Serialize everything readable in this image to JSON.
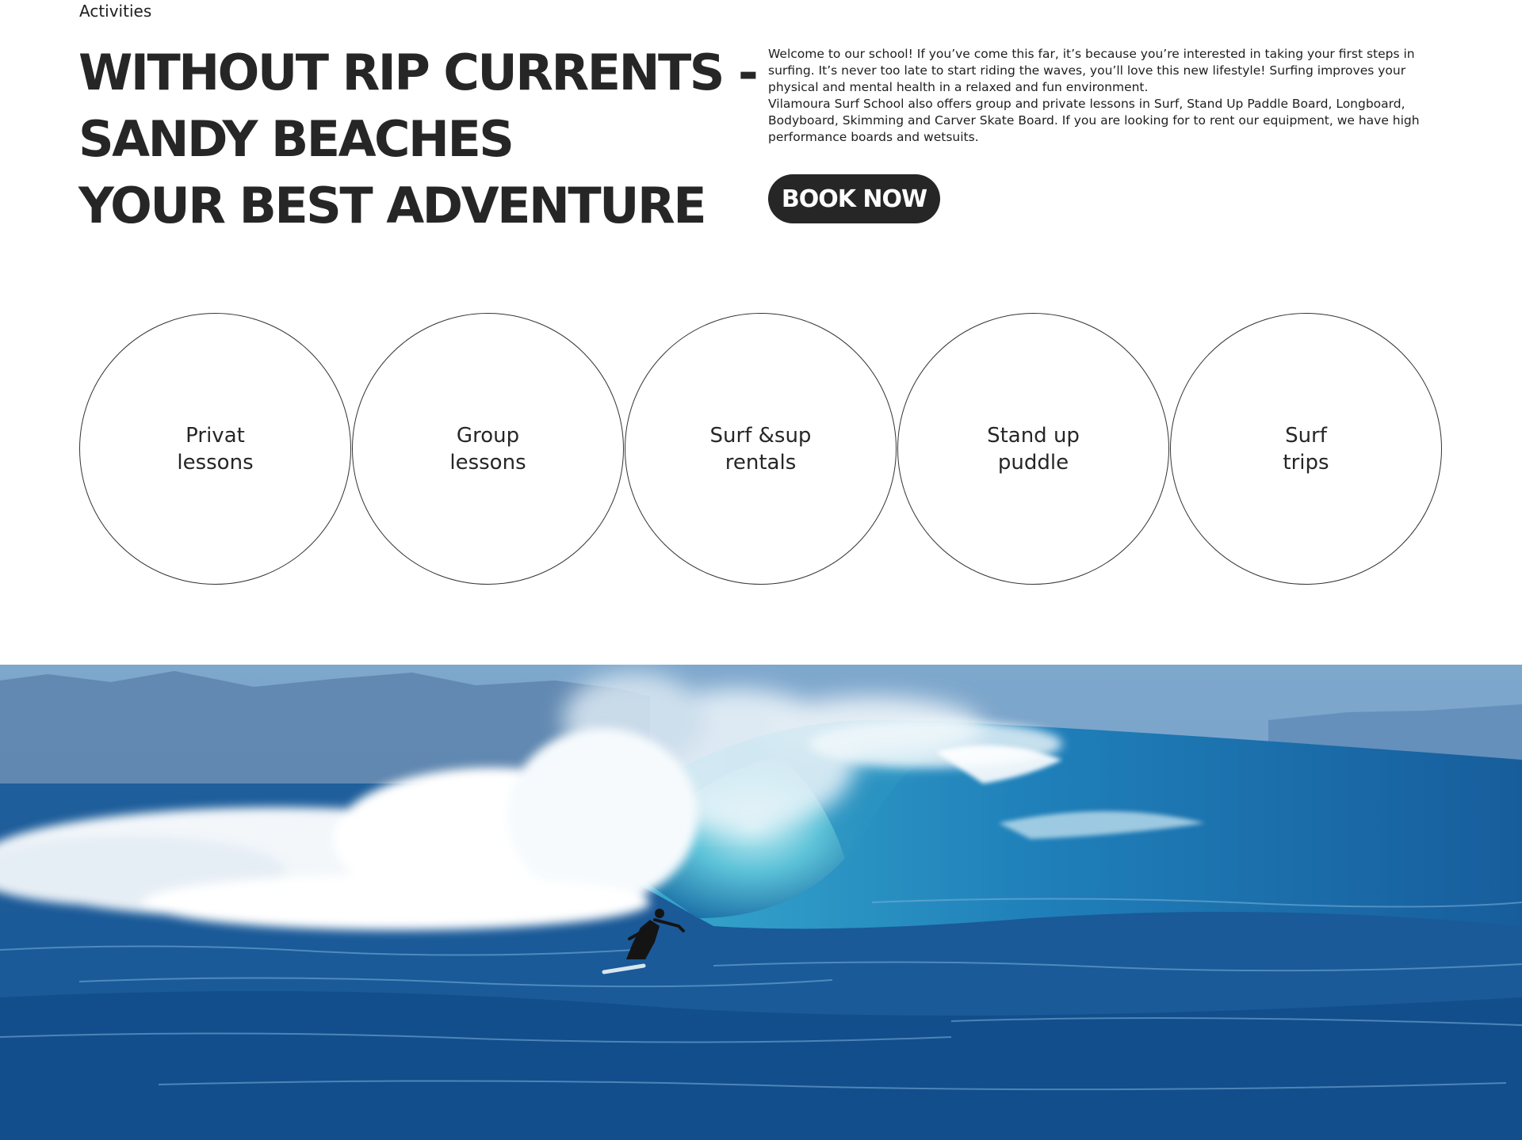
{
  "section": {
    "label": "Activities"
  },
  "headline": {
    "line1": "WITHOUT RIP CURRENTS -",
    "line2": "SANDY BEACHES",
    "line3": "YOUR BEST ADVENTURE"
  },
  "intro": {
    "paragraph1": "Welcome to our school! If you’ve come this far, it’s because you’re interested in taking your first steps in surfing. It’s never too late to start riding the waves, you’ll love this new lifestyle! Surfing improves your physical and mental health in a relaxed and fun environment.",
    "paragraph2": "Vilamoura Surf School also offers group and private lessons in Surf, Stand Up Paddle Board, Longboard, Bodyboard, Skimming and Carver Skate Board. If you are looking for to rent our equipment, we have high performance boards and wetsuits."
  },
  "cta": {
    "book_label": "BOOK NOW"
  },
  "activities": [
    {
      "line1": "Privat",
      "line2": "lessons"
    },
    {
      "line1": "Group",
      "line2": "lessons"
    },
    {
      "line1": "Surf &sup",
      "line2": "rentals"
    },
    {
      "line1": "Stand up",
      "line2": "puddle"
    },
    {
      "line1": "Surf",
      "line2": "trips"
    }
  ],
  "colors": {
    "text": "#262626",
    "button_bg": "#262626",
    "button_text": "#ffffff",
    "circle_border": "#333333"
  },
  "hero": {
    "image_subject": "surfer riding a barrel wave"
  }
}
